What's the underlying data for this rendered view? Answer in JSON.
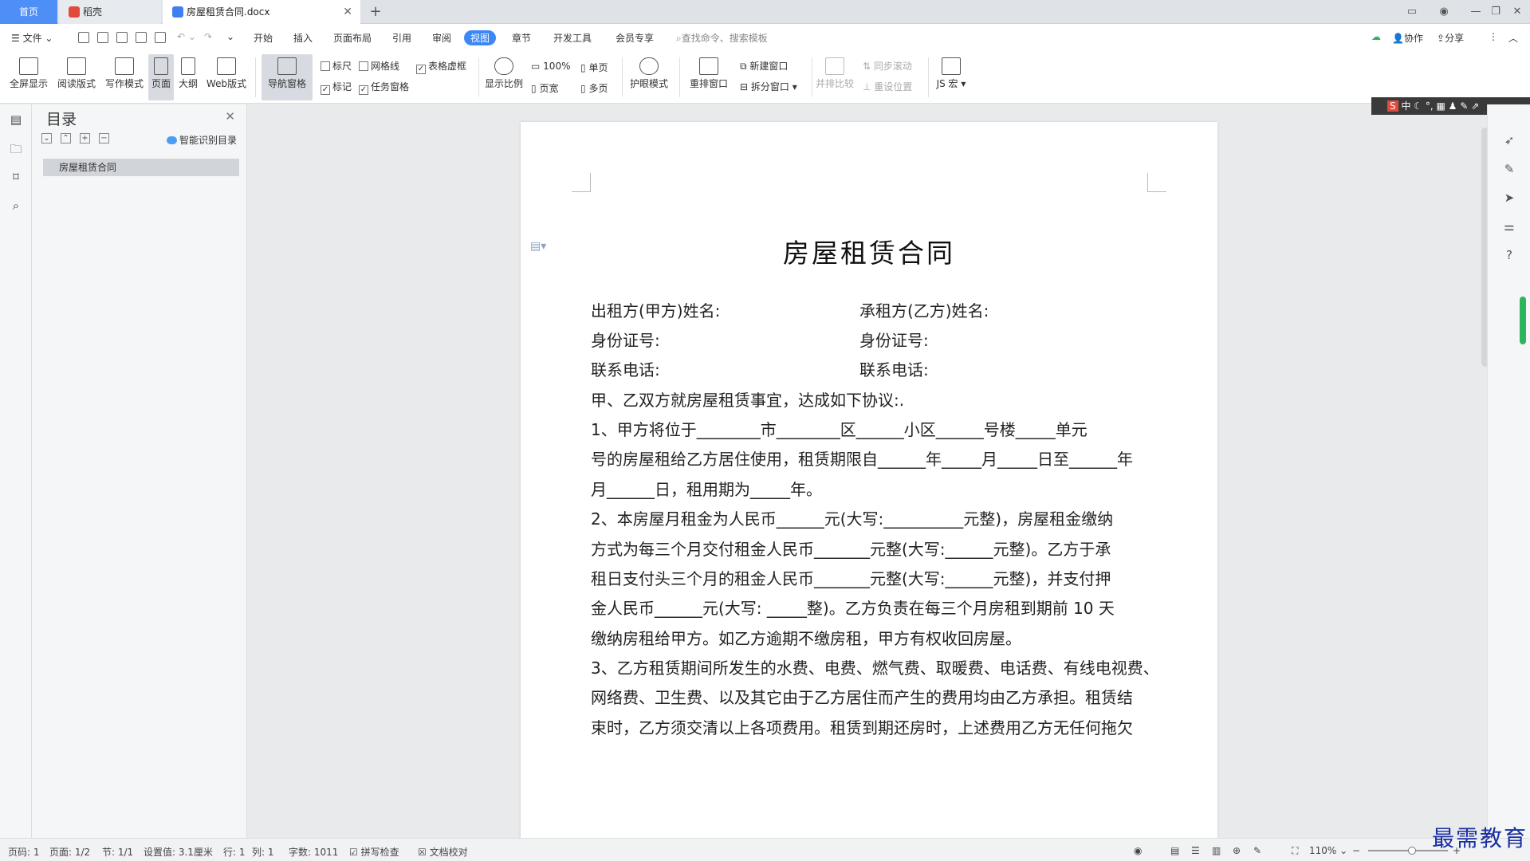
{
  "tabs": {
    "home": "首页",
    "daoke": "稻壳",
    "document": "房屋租赁合同.docx"
  },
  "menu": {
    "file": "文件",
    "items": [
      "开始",
      "插入",
      "页面布局",
      "引用",
      "审阅",
      "视图",
      "章节",
      "开发工具",
      "会员专享"
    ],
    "search_placeholder": "查找命令、搜索模板",
    "collab": "协作",
    "share": "分享"
  },
  "ribbon": {
    "fullscreen": "全屏显示",
    "reading": "阅读版式",
    "writing": "写作模式",
    "page": "页面",
    "outline": "大纲",
    "web": "Web版式",
    "navpane": "导航窗格",
    "ruler": "标尺",
    "gridlines": "网格线",
    "table_border": "表格虚框",
    "marks": "标记",
    "task_pane": "任务窗格",
    "zoom_ratio": "显示比例",
    "zoom100": "100%",
    "page_width": "页宽",
    "single_page": "单页",
    "multi_page": "多页",
    "eye_mode": "护眼模式",
    "arrange": "重排窗口",
    "new_window": "新建窗口",
    "split_window": "拆分窗口",
    "side_by_side": "并排比较",
    "sync_scroll": "同步滚动",
    "reset_pos": "重设位置",
    "js_macro": "JS 宏"
  },
  "nav": {
    "title": "目录",
    "smart": "智能识别目录",
    "items": [
      "房屋租赁合同"
    ]
  },
  "document": {
    "title": "房屋租赁合同",
    "lines": [
      "出租方(甲方)姓名:",
      "身份证号:",
      "联系电话:",
      "甲、乙双方就房屋租赁事宜，达成如下协议:.",
      "1、甲方将位于________市________区______小区______号楼_____单元",
      "号的房屋租给乙方居住使用，租赁期限自______年_____月_____日至______年",
      "月______日，租用期为_____年。",
      "2、本房屋月租金为人民币______元(大写:__________元整)，房屋租金缴纳",
      "方式为每三个月交付租金人民币_______元整(大写:______元整)。乙方于承",
      "租日支付头三个月的租金人民币_______元整(大写:______元整)，并支付押",
      "金人民币______元(大写: _____整)。乙方负责在每三个月房租到期前 10 天",
      "缴纳房租给甲方。如乙方逾期不缴房租，甲方有权收回房屋。",
      "3、乙方租赁期间所发生的水费、电费、燃气费、取暖费、电话费、有线电视费、",
      "网络费、卫生费、以及其它由于乙方居住而产生的费用均由乙方承担。租赁结",
      "束时，乙方须交清以上各项费用。租赁到期还房时，上述费用乙方无任何拖欠"
    ],
    "lines_right": [
      "承租方(乙方)姓名:",
      "身份证号:",
      "联系电话:"
    ]
  },
  "ime": "中",
  "status": {
    "page_num": "页码: 1",
    "pages": "页面: 1/2",
    "section": "节: 1/1",
    "setting": "设置值: 3.1厘米",
    "row": "行: 1",
    "col": "列: 1",
    "words": "字数: 1011",
    "spell": "拼写检查",
    "proof": "文档校对",
    "zoom": "110%",
    "zoom_level_fraction": 0.55
  },
  "watermark": "最需教育",
  "colors": {
    "accent": "#3c88f5",
    "home_tab": "#4e8ef7",
    "ime_green": "#2eb35e",
    "watermark": "#1a2fa0"
  }
}
